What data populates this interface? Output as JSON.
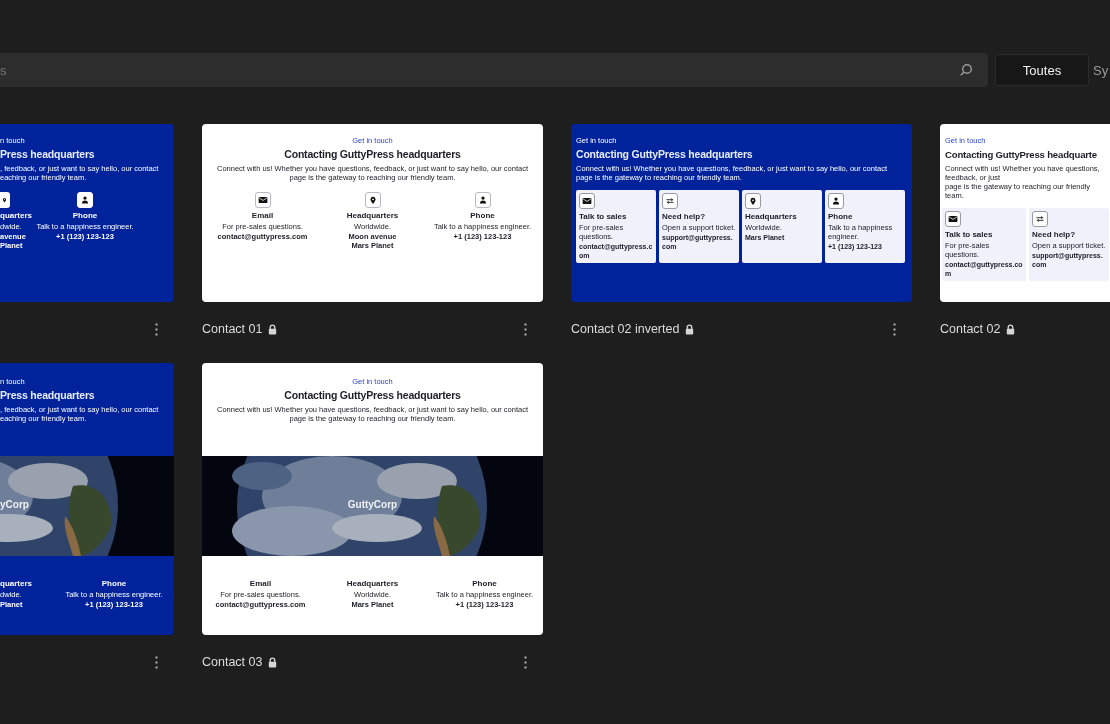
{
  "search": {
    "placeholder": "s"
  },
  "filters": [
    {
      "label": "Toutes",
      "selected": true
    },
    {
      "label": "Sy",
      "selected": false
    }
  ],
  "patterns": [
    {
      "preview": {
        "kind": "centered",
        "inverted": true,
        "cropped_left": true,
        "cropped_right": false,
        "eyebrow": "n touch",
        "heading": "Press headquarters",
        "description": [
          ", feedback, or just want to say hello, our contact",
          "eaching our friendly team."
        ],
        "features": [
          {
            "kind": "pin",
            "title": "quarters",
            "subtitle": "dwide.",
            "detail": [
              "avenue",
              "Planet"
            ]
          },
          {
            "kind": "person",
            "title": "Phone",
            "subtitle": "Talk to a happiness engineer.",
            "detail": [
              "+1 (123) 123-123"
            ]
          }
        ]
      }
    },
    {
      "title": "Contact 01",
      "locked": true,
      "preview": {
        "kind": "centered",
        "inverted": false,
        "cropped_left": false,
        "cropped_right": false,
        "eyebrow": "Get in touch",
        "heading": "Contacting GuttyPress headquarters",
        "description": [
          "Connect with us! Whether you have questions, feedback, or just want to say hello, our contact",
          "page is the gateway to reaching our friendly team."
        ],
        "features": [
          {
            "kind": "mail",
            "title": "Email",
            "subtitle": "For pre-sales questions.",
            "detail": [
              "contact@guttypress.com"
            ]
          },
          {
            "kind": "pin",
            "title": "Headquarters",
            "subtitle": "Worldwide.",
            "detail": [
              "Moon avenue",
              "Mars Planet"
            ]
          },
          {
            "kind": "person",
            "title": "Phone",
            "subtitle": "Talk to a happiness engineer.",
            "detail": [
              "+1 (123) 123-123"
            ]
          }
        ]
      }
    },
    {
      "title": "Contact 02 inverted",
      "locked": true,
      "preview": {
        "kind": "boxes",
        "inverted": true,
        "cropped_left": false,
        "cropped_right": false,
        "eyebrow": "Get in touch",
        "heading": "Contacting GuttyPress headquarters",
        "description": [
          "Connect with us! Whether you have questions, feedback, or just want to say hello, our contact",
          "page is the gateway to reaching our friendly team."
        ],
        "features": [
          {
            "kind": "mail",
            "title": "Talk to sales",
            "subtitle": "For pre-sales questions.",
            "detail": [
              "contact@guttypress.com"
            ]
          },
          {
            "kind": "swap",
            "title": "Need help?",
            "subtitle": "Open a support ticket.",
            "detail": [
              "support@guttypress.com"
            ]
          },
          {
            "kind": "pin",
            "title": "Headquarters",
            "subtitle": "Worldwide.",
            "detail": [
              "Mars Planet"
            ]
          },
          {
            "kind": "person",
            "title": "Phone",
            "subtitle": "Talk to a happiness engineer.",
            "detail": [
              "+1 (123) 123-123"
            ]
          }
        ]
      }
    },
    {
      "title": "Contact 02",
      "locked": true,
      "preview": {
        "kind": "boxes",
        "inverted": false,
        "cropped_left": false,
        "cropped_right": true,
        "eyebrow": "Get in touch",
        "heading": "Contacting GuttyPress headquarte",
        "description": [
          "Connect with us! Whether you have questions, feedback, or just",
          "page is the gateway to reaching our friendly team."
        ],
        "features": [
          {
            "kind": "mail",
            "title": "Talk to sales",
            "subtitle": "For pre-sales questions.",
            "detail": [
              "contact@guttypress.com"
            ]
          },
          {
            "kind": "swap",
            "title": "Need help?",
            "subtitle": "Open a support ticket.",
            "detail": [
              "support@guttypress.com"
            ]
          }
        ]
      }
    },
    {
      "preview": {
        "inverted": true,
        "cropped_left": true,
        "cropped_right": false,
        "eyebrow": "n touch",
        "heading": "Press headquarters",
        "description": [
          ", feedback, or just want to say hello, our contact",
          "eaching our friendly team."
        ],
        "banner": "yCorp",
        "features": [
          {
            "title": "quarters",
            "subtitle": "dwide.",
            "detail": [
              "Planet"
            ]
          },
          {
            "title": "Phone",
            "subtitle": "Talk to a happiness engineer.",
            "detail": [
              "+1 (123) 123-123"
            ]
          }
        ]
      }
    },
    {
      "title": "Contact 03",
      "locked": true,
      "preview": {
        "inverted": false,
        "cropped_left": false,
        "cropped_right": false,
        "eyebrow": "Get in touch",
        "heading": "Contacting GuttyPress headquarters",
        "description": [
          "Connect with us! Whether you have questions, feedback, or just want to say hello, our contact",
          "page is the gateway to reaching our friendly team."
        ],
        "banner": "GuttyCorp",
        "features": [
          {
            "title": "Email",
            "subtitle": "For pre-sales questions.",
            "detail": [
              "contact@guttypress.com"
            ]
          },
          {
            "title": "Headquarters",
            "subtitle": "Worldwide.",
            "detail": [
              "Mars Planet"
            ]
          },
          {
            "title": "Phone",
            "subtitle": "Talk to a happiness engineer.",
            "detail": [
              "+1 (123) 123-123"
            ]
          }
        ]
      }
    }
  ]
}
